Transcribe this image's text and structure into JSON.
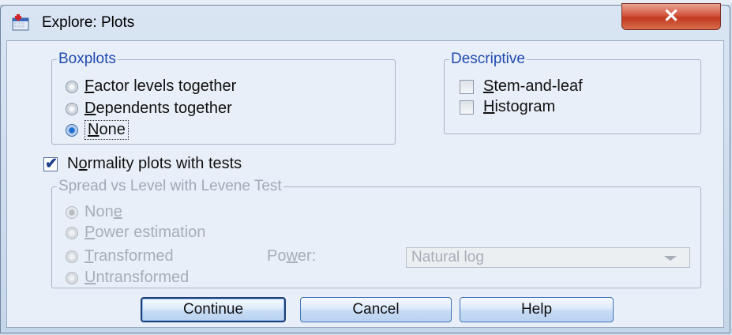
{
  "window": {
    "title": "Explore: Plots",
    "close_glyph": "✕"
  },
  "boxplots": {
    "label": "Boxplots",
    "options": [
      {
        "pre": "",
        "u": "F",
        "post": "actor levels together",
        "selected": false
      },
      {
        "pre": "",
        "u": "D",
        "post": "ependents together",
        "selected": false
      },
      {
        "pre": "",
        "u": "N",
        "post": "one",
        "selected": true
      }
    ]
  },
  "descriptive": {
    "label": "Descriptive",
    "options": [
      {
        "pre": "",
        "u": "S",
        "post": "tem-and-leaf",
        "checked": false
      },
      {
        "pre": "",
        "u": "H",
        "post": "istogram",
        "checked": false
      }
    ]
  },
  "normality": {
    "pre": "N",
    "u": "o",
    "post": "rmality plots with tests",
    "checked": true
  },
  "spread": {
    "label": "Spread vs Level with Levene Test",
    "options": [
      {
        "pre": "Non",
        "u": "e",
        "post": "",
        "selected": true
      },
      {
        "pre": "",
        "u": "P",
        "post": "ower estimation",
        "selected": false
      },
      {
        "pre": "",
        "u": "T",
        "post": "ransformed",
        "selected": false
      },
      {
        "pre": "",
        "u": "U",
        "post": "ntransformed",
        "selected": false
      }
    ],
    "power": {
      "pre": "Po",
      "u": "w",
      "post": "er:"
    },
    "power_value": "Natural log"
  },
  "buttons": {
    "continue": "Continue",
    "cancel": "Cancel",
    "help": "Help"
  },
  "colors": {
    "accent": "#1f4ab0",
    "close": "#c13a22"
  },
  "icons": {
    "app": "spss-data-editor-icon"
  }
}
